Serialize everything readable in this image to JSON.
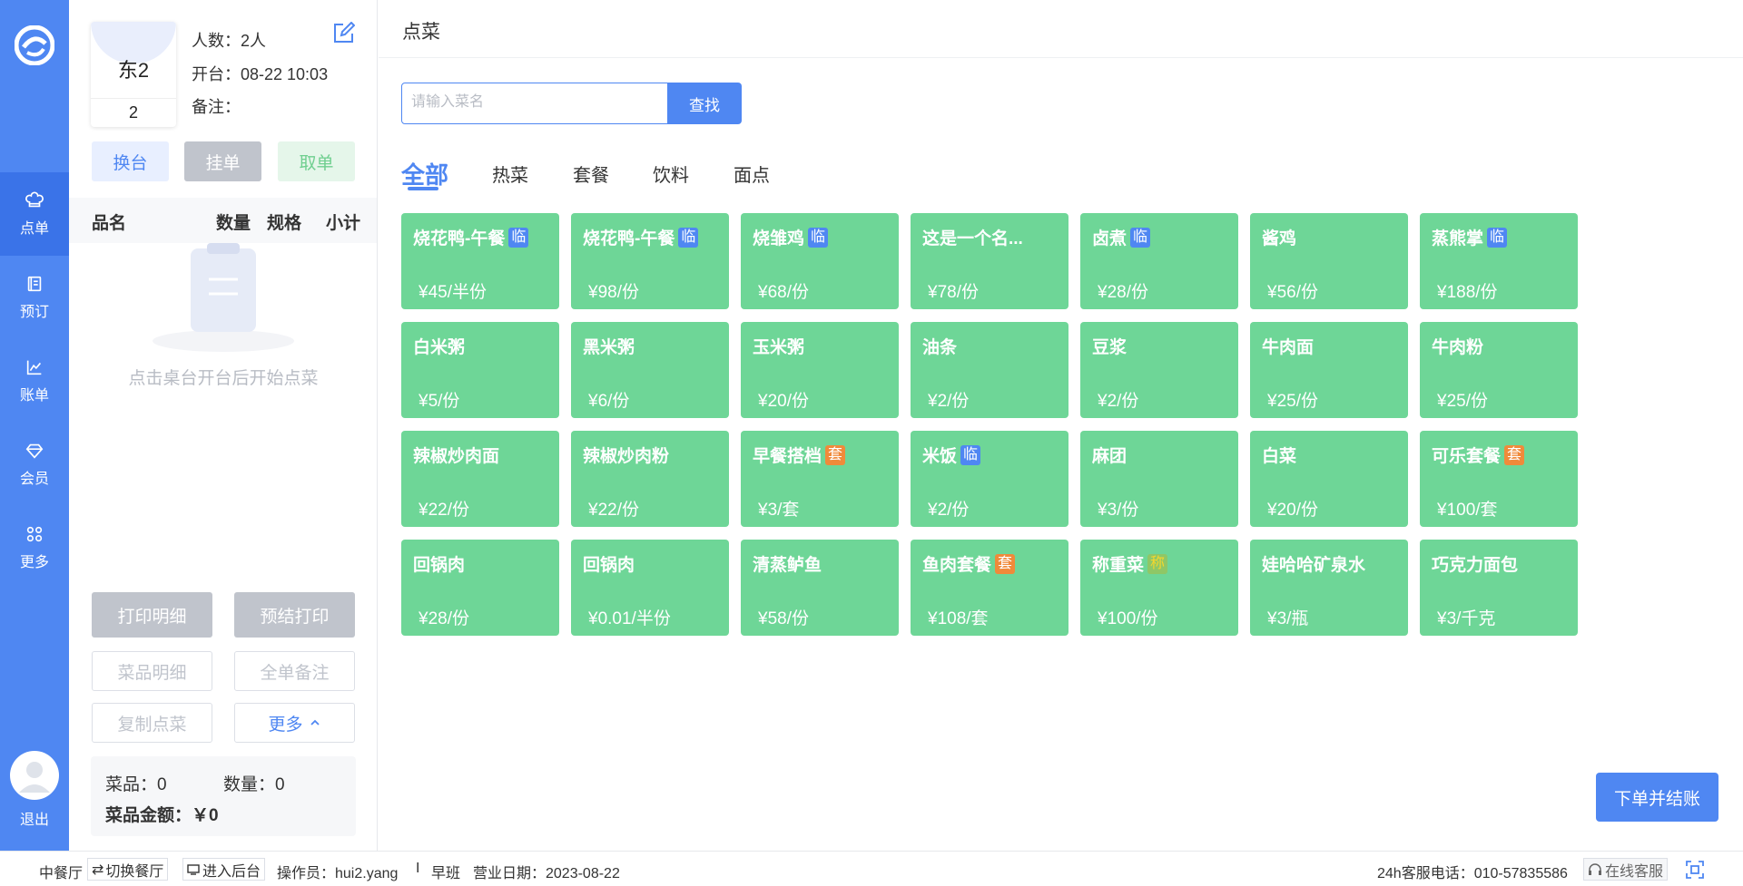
{
  "nav": {
    "items": [
      {
        "label": "点单",
        "icon": "chef-hat-icon"
      },
      {
        "label": "预订",
        "icon": "booking-icon"
      },
      {
        "label": "账单",
        "icon": "chart-icon"
      },
      {
        "label": "会员",
        "icon": "diamond-icon"
      },
      {
        "label": "更多",
        "icon": "grid-icon"
      }
    ],
    "logout": "退出"
  },
  "order": {
    "table_name": "东2",
    "table_number": "2",
    "guests": "人数：2人",
    "open_time": "开台：08-22 10:03",
    "remark": "备注：",
    "buttons": {
      "swap": "换台",
      "hold": "挂单",
      "take": "取单"
    },
    "columns": [
      "品名",
      "数量",
      "规格",
      "小计"
    ],
    "empty_text": "点击桌台开台后开始点菜",
    "actions": {
      "print_detail": "打印明细",
      "pre_print": "预结打印",
      "dish_detail": "菜品明细",
      "order_remark": "全单备注",
      "copy_order": "复制点菜",
      "more": "更多"
    },
    "summary": {
      "dishes": "菜品：0",
      "quantity": "数量：0",
      "amount": "菜品金额：￥0"
    }
  },
  "main": {
    "title": "点菜",
    "search": {
      "placeholder": "请输入菜名",
      "button": "查找"
    },
    "tabs": [
      "全部",
      "热菜",
      "套餐",
      "饮料",
      "面点"
    ],
    "active_tab": "全部",
    "dishes": [
      {
        "name": "烧花鸭-午餐",
        "badge": "临",
        "price": "¥45/半份"
      },
      {
        "name": "烧花鸭-午餐",
        "badge": "临",
        "price": "¥98/份"
      },
      {
        "name": "烧雏鸡",
        "badge": "临",
        "price": "¥68/份"
      },
      {
        "name": "这是一个名...",
        "badge": "",
        "price": "¥78/份"
      },
      {
        "name": "卤煮",
        "badge": "临",
        "price": "¥28/份"
      },
      {
        "name": "酱鸡",
        "badge": "",
        "price": "¥56/份"
      },
      {
        "name": "蒸熊掌",
        "badge": "临",
        "price": "¥188/份"
      },
      {
        "name": "白米粥",
        "badge": "",
        "price": "¥5/份"
      },
      {
        "name": "黑米粥",
        "badge": "",
        "price": "¥6/份"
      },
      {
        "name": "玉米粥",
        "badge": "",
        "price": "¥20/份"
      },
      {
        "name": "油条",
        "badge": "",
        "price": "¥2/份"
      },
      {
        "name": "豆浆",
        "badge": "",
        "price": "¥2/份"
      },
      {
        "name": "牛肉面",
        "badge": "",
        "price": "¥25/份"
      },
      {
        "name": "牛肉粉",
        "badge": "",
        "price": "¥25/份"
      },
      {
        "name": "辣椒炒肉面",
        "badge": "",
        "price": "¥22/份"
      },
      {
        "name": "辣椒炒肉粉",
        "badge": "",
        "price": "¥22/份"
      },
      {
        "name": "早餐搭档",
        "badge": "套",
        "price": "¥3/套"
      },
      {
        "name": "米饭",
        "badge": "临",
        "price": "¥2/份"
      },
      {
        "name": "麻团",
        "badge": "",
        "price": "¥3/份"
      },
      {
        "name": "白菜",
        "badge": "",
        "price": "¥20/份"
      },
      {
        "name": "可乐套餐",
        "badge": "套",
        "price": "¥100/套"
      },
      {
        "name": "回锅肉",
        "badge": "",
        "price": "¥28/份"
      },
      {
        "name": "回锅肉",
        "badge": "",
        "price": "¥0.01/半份"
      },
      {
        "name": "清蒸鲈鱼",
        "badge": "",
        "price": "¥58/份"
      },
      {
        "name": "鱼肉套餐",
        "badge": "套",
        "price": "¥108/套"
      },
      {
        "name": "称重菜",
        "badge": "称",
        "price": "¥100/份"
      },
      {
        "name": "娃哈哈矿泉水",
        "badge": "",
        "price": "¥3/瓶"
      },
      {
        "name": "巧克力面包",
        "badge": "",
        "price": "¥3/千克"
      }
    ],
    "checkout": "下单并结账"
  },
  "status": {
    "restaurant": "中餐厅",
    "switch": "切换餐厅",
    "backend": "进入后台",
    "operator": "操作员：hui2.yang",
    "divider": "I",
    "shift": "早班",
    "business_date": "营业日期：2023-08-22",
    "hotline": "24h客服电话：010-57835586",
    "online_service": "在线客服"
  },
  "colors": {
    "primary": "#4f87f2",
    "dish_green": "#6ed697",
    "badge_temp": "#4f87f2",
    "badge_set": "#f08a3a",
    "badge_weigh": "#8fc766"
  }
}
